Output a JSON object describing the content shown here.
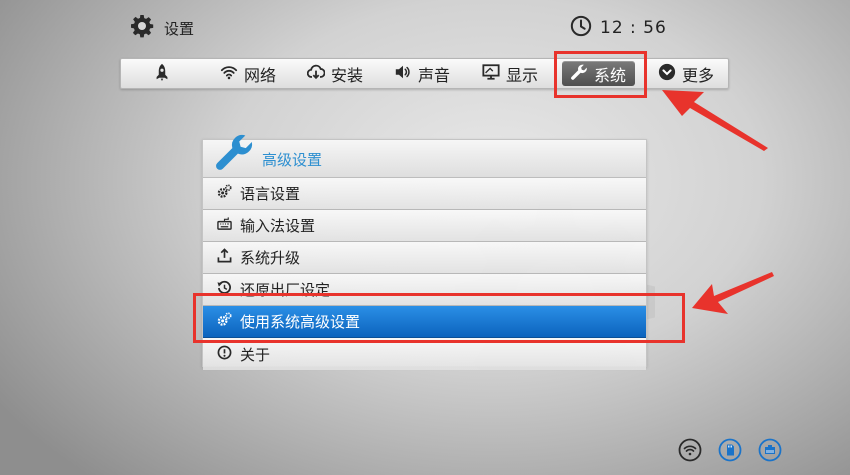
{
  "header": {
    "title": "设置",
    "icon": "gear-icon"
  },
  "clock": {
    "time": "12 : 56",
    "icon": "clock-icon"
  },
  "nav": {
    "items": [
      {
        "key": "home",
        "label": "",
        "icon": "rocket-icon"
      },
      {
        "key": "network",
        "label": "网络",
        "icon": "wifi-icon"
      },
      {
        "key": "install",
        "label": "安装",
        "icon": "cloud-download-icon"
      },
      {
        "key": "sound",
        "label": "声音",
        "icon": "speaker-icon"
      },
      {
        "key": "display",
        "label": "显示",
        "icon": "monitor-icon"
      },
      {
        "key": "system",
        "label": "系统",
        "icon": "wrench-icon",
        "active": true
      },
      {
        "key": "more",
        "label": "更多",
        "icon": "chevron-down-circle-icon"
      }
    ]
  },
  "panel": {
    "title": "高级设置",
    "icon": "wrench-icon",
    "items": [
      {
        "label": "语言设置",
        "icon": "gears-icon"
      },
      {
        "label": "输入法设置",
        "icon": "keyboard-icon"
      },
      {
        "label": "系统升级",
        "icon": "upgrade-icon"
      },
      {
        "label": "还原出厂设定",
        "icon": "restore-icon"
      },
      {
        "label": "使用系统高级设置",
        "icon": "gears-icon",
        "selected": true
      },
      {
        "label": "关于",
        "icon": "info-icon"
      }
    ]
  },
  "status": [
    {
      "icon": "wifi-status-icon"
    },
    {
      "icon": "sd-card-icon"
    },
    {
      "icon": "ethernet-icon"
    }
  ],
  "colors": {
    "accent": "#2d8fd0",
    "selected": "#1477d4",
    "annotation": "#e8332c",
    "nav_active": "#5e5e5e"
  }
}
